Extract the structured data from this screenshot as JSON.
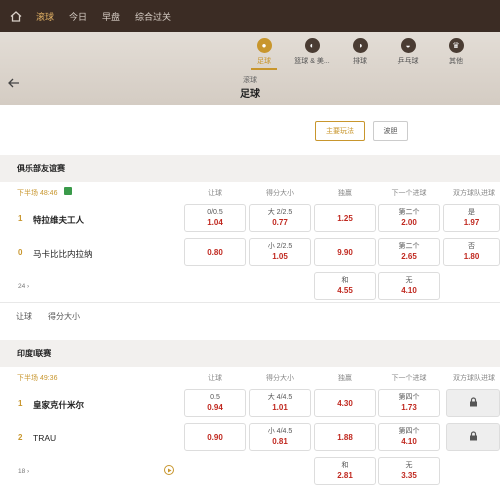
{
  "topnav": {
    "items": [
      {
        "label": "滚球",
        "active": true
      },
      {
        "label": "今日",
        "active": false
      },
      {
        "label": "早盘",
        "active": false
      },
      {
        "label": "综合过关",
        "active": false
      }
    ]
  },
  "sports": [
    {
      "label": "足球",
      "icon": "soccer-ball-icon",
      "active": true
    },
    {
      "label": "篮球 & 美...",
      "icon": "basketball-icon",
      "active": false
    },
    {
      "label": "排球",
      "icon": "volleyball-icon",
      "active": false
    },
    {
      "label": "乒乓球",
      "icon": "ping-pong-icon",
      "active": false
    },
    {
      "label": "其他",
      "icon": "trophy-icon",
      "active": false
    }
  ],
  "crumb": "滚球",
  "page_title": "足球",
  "filters": {
    "main": "主要玩法",
    "wave": "波胆"
  },
  "columns": [
    "让球",
    "得分大小",
    "独赢",
    "下一个进球",
    "双方球队进球"
  ],
  "leagues": [
    {
      "name": "俱乐部友谊赛",
      "time": "下半场 48:46",
      "rows": [
        {
          "num": "1",
          "team": "特拉维夫工人",
          "bold": true,
          "cells": [
            {
              "lbl": "0/0.5",
              "val": "1.04"
            },
            {
              "lbl": "大 2/2.5",
              "val": "0.77"
            },
            {
              "lbl": "",
              "val": "1.25"
            },
            {
              "lbl": "第二个",
              "val": "2.00"
            },
            {
              "lbl": "是",
              "val": "1.97"
            }
          ]
        },
        {
          "num": "0",
          "team": "马卡比比内拉纳",
          "bold": false,
          "cells": [
            {
              "lbl": "",
              "val": "0.80"
            },
            {
              "lbl": "小 2/2.5",
              "val": "1.05"
            },
            {
              "lbl": "",
              "val": "9.90"
            },
            {
              "lbl": "第二个",
              "val": "2.65"
            },
            {
              "lbl": "否",
              "val": "1.80"
            }
          ]
        }
      ],
      "more": "24",
      "draw": {
        "lbl": "和",
        "val": "4.55"
      },
      "none": {
        "lbl": "无",
        "val": "4.10"
      }
    },
    {
      "name": "印度I联赛",
      "time": "下半场 49:36",
      "rows": [
        {
          "num": "1",
          "team": "皇家克什米尔",
          "bold": true,
          "cells": [
            {
              "lbl": "0.5",
              "val": "0.94"
            },
            {
              "lbl": "大 4/4.5",
              "val": "1.01"
            },
            {
              "lbl": "",
              "val": "4.30"
            },
            {
              "lbl": "第四个",
              "val": "1.73"
            },
            {
              "lbl": "",
              "val": ""
            }
          ]
        },
        {
          "num": "2",
          "team": "TRAU",
          "bold": false,
          "cells": [
            {
              "lbl": "",
              "val": "0.90"
            },
            {
              "lbl": "小 4/4.5",
              "val": "0.81"
            },
            {
              "lbl": "",
              "val": "1.88"
            },
            {
              "lbl": "第四个",
              "val": "4.10"
            },
            {
              "lbl": "",
              "val": ""
            }
          ]
        }
      ],
      "more": "18",
      "draw": {
        "lbl": "和",
        "val": "2.81"
      },
      "none": {
        "lbl": "无",
        "val": "3.35"
      }
    }
  ],
  "sub_tabs": [
    "让球",
    "得分大小"
  ],
  "colors": {
    "accent": "#c8962d",
    "odds": "#c0281f",
    "topbar": "#3b2c24"
  }
}
